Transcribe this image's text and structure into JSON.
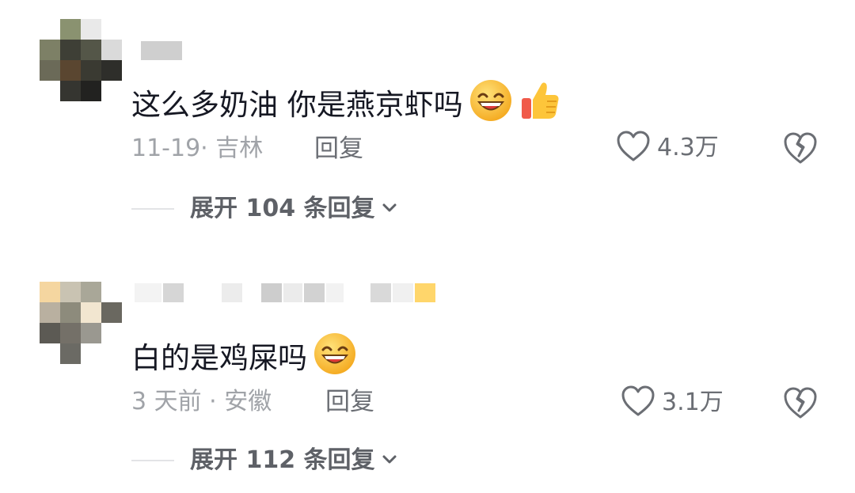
{
  "comments": [
    {
      "text": "这么多奶油 你是燕京虾吗",
      "emojis": [
        "grinning-squint-emoji",
        "thumbs-up-emoji"
      ],
      "meta": "11-19· 吉林",
      "reply_label": "回复",
      "likes": "4.3万",
      "expand_label": "展开 104 条回复"
    },
    {
      "text": "白的是鸡屎吗",
      "emojis": [
        "grinning-squint-emoji"
      ],
      "meta": "3 天前 · 安徽",
      "reply_label": "回复",
      "likes": "3.1万",
      "expand_label": "展开 112 条回复"
    }
  ],
  "colors": {
    "text_primary": "#161823",
    "text_secondary": "#a0a3a8",
    "action_gray": "#6b6e74",
    "emoji_yellow": "#f9b928",
    "emoji_mouth": "#e03a3a"
  }
}
